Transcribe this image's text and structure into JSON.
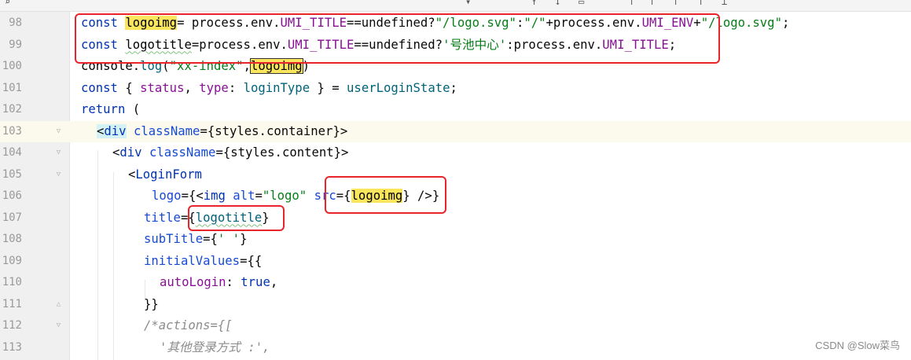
{
  "watermark": "CSDN @Slow菜鸟",
  "lines": [
    {
      "num": "98"
    },
    {
      "num": "99"
    },
    {
      "num": "100"
    },
    {
      "num": "101"
    },
    {
      "num": "102"
    },
    {
      "num": "103"
    },
    {
      "num": "104"
    },
    {
      "num": "105"
    },
    {
      "num": "106"
    },
    {
      "num": "107"
    },
    {
      "num": "108"
    },
    {
      "num": "109"
    },
    {
      "num": "110"
    },
    {
      "num": "111"
    },
    {
      "num": "112"
    },
    {
      "num": "113"
    }
  ],
  "code": {
    "l98": {
      "kw": "const",
      "var": "logoimg",
      "rest1": "= process.env.",
      "const1": "UMI_TITLE",
      "rest2": "==undefined?",
      "str1": "\"/logo.svg\"",
      "rest3": ":",
      "str2": "\"/\"",
      "rest4": "+process.env.",
      "const2": "UMI_ENV",
      "rest5": "+",
      "str3": "\"/logo.svg\"",
      "rest6": ";"
    },
    "l99": {
      "kw": "const",
      "var": "logotitle",
      "rest1": "=process.env.",
      "const1": "UMI_TITLE",
      "rest2": "==undefined?",
      "str1": "'号池中心'",
      "rest3": ":process.env.",
      "const2": "UMI_TITLE",
      "rest4": ";"
    },
    "l100": {
      "pre": "console.",
      "fn": "log",
      "open": "(",
      "str": "\"xx-index\"",
      "comma": ",",
      "var": "logoimg",
      "close": ")"
    },
    "l101": {
      "kw": "const",
      "open": " { ",
      "prop1": "status",
      "c1": ", ",
      "prop2": "type",
      "c2": ": ",
      "fn1": "loginType",
      "c3": " } = ",
      "fn2": "userLoginState",
      "end": ";"
    },
    "l102": {
      "kw": "return",
      "rest": " ("
    },
    "l103": {
      "lt": "<",
      "tag": "div",
      "attr": "className",
      "rest": "={styles.container}>"
    },
    "l104": {
      "lt": "<",
      "tag": "div",
      "attr": "className",
      "rest": "={styles.content}>"
    },
    "l105": {
      "lt": "<",
      "tag": "LoginForm"
    },
    "l106": {
      "attr1": "logo",
      "p1": "={<",
      "tag": "img",
      "attr2": "alt",
      "eq": "=",
      "str": "\"logo\"",
      "attr3": "src",
      "p2": "={",
      "var": "logoimg",
      "p3": "} />}"
    },
    "l107": {
      "attr": "title",
      "p1": "={",
      "var": "logotitle",
      "p2": "}"
    },
    "l108": {
      "attr": "subTitle",
      "p1": "={",
      "str": "' '",
      "p2": "}"
    },
    "l109": {
      "attr": "initialValues",
      "p1": "={{"
    },
    "l110": {
      "prop": "autoLogin",
      "p1": ": ",
      "kw": "true",
      "p2": ","
    },
    "l111": {
      "text": "}}"
    },
    "l112": {
      "cmt": "/*actions={["
    },
    "l113": {
      "cmt": "'其他登录方式 :',"
    }
  }
}
